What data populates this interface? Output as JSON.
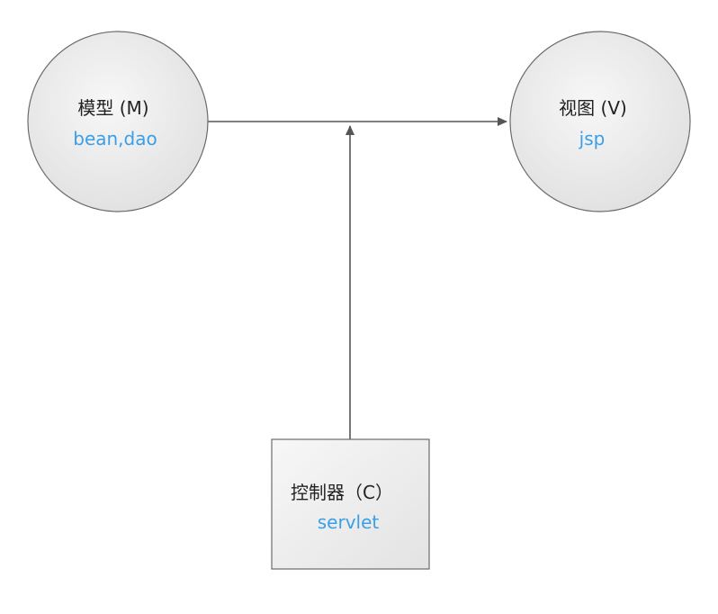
{
  "diagram": {
    "model": {
      "title": "模型 (M)",
      "subtitle": "bean,dao"
    },
    "view": {
      "title": "视图 (V)",
      "subtitle": "jsp"
    },
    "controller": {
      "title": "控制器（C）",
      "subtitle": "servlet"
    }
  },
  "colors": {
    "node_fill_light": "#f7f7f7",
    "node_fill_dark": "#e0e0e0",
    "node_stroke": "#6b6b6b",
    "arrow": "#555555",
    "subtitle_text": "#3a9fe6",
    "title_text": "#222222"
  }
}
